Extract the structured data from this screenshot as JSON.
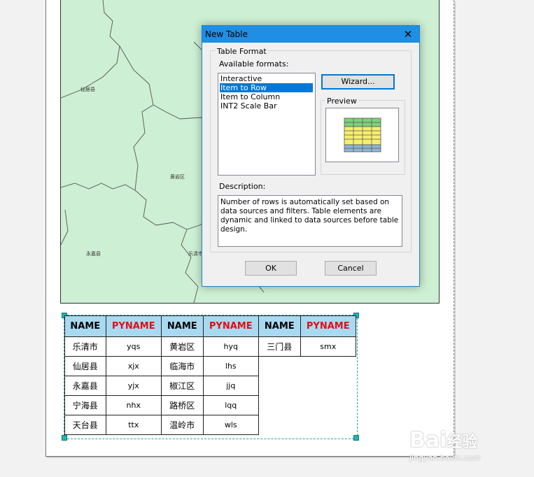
{
  "map": {
    "county_labels": [
      "仙居县",
      "黄岩区",
      "永嘉县",
      "乐清市"
    ]
  },
  "dialog": {
    "title": "New Table",
    "close_glyph": "✕",
    "table_format_group": "Table Format",
    "available_formats_label": "Available formats:",
    "formats": [
      "Interactive",
      "Item to Row",
      "Item to Column",
      "INT2 Scale Bar"
    ],
    "selected_format": "Item to Row",
    "wizard_button": "Wizard...",
    "preview_label": "Preview",
    "description_label": "Description:",
    "description": "Number of rows is automatically set based on data sources and filters. Table elements are dynamic and linked to data sources before table design.",
    "ok_button": "OK",
    "cancel_button": "Cancel"
  },
  "layout_table": {
    "headers": [
      "NAME",
      "PYNAME",
      "NAME",
      "PYNAME",
      "NAME",
      "PYNAME"
    ],
    "block1": [
      [
        "乐清市",
        "yqs"
      ],
      [
        "仙居县",
        "xjx"
      ],
      [
        "永嘉县",
        "yjx"
      ],
      [
        "宁海县",
        "nhx"
      ],
      [
        "天台县",
        "ttx"
      ]
    ],
    "block2": [
      [
        "黄岩区",
        "hyq"
      ],
      [
        "临海市",
        "lhs"
      ],
      [
        "椒江区",
        "jjq"
      ],
      [
        "路桥区",
        "lqq"
      ],
      [
        "温岭市",
        "wls"
      ]
    ],
    "block3": [
      [
        "三门县",
        "smx"
      ]
    ]
  },
  "colors": {
    "header_bg": "#a9d9f1",
    "pyname_red": "#e01010",
    "selection": "#0078d7",
    "map_fill": "#cdefd3"
  },
  "watermark": {
    "brand": "Bai",
    "brand2": "经验",
    "url": "jingyan.baidu.com"
  }
}
